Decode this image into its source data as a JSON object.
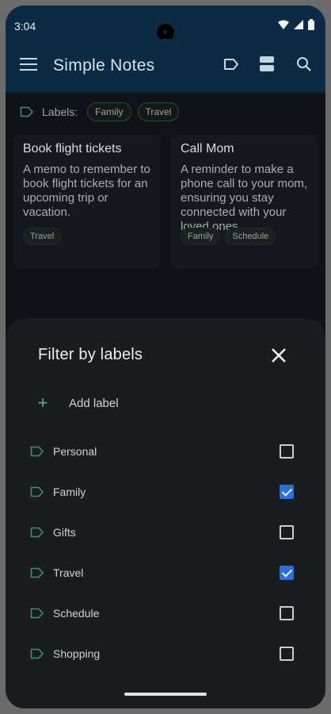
{
  "status_bar": {
    "time": "3:04"
  },
  "app_bar": {
    "title": "Simple Notes"
  },
  "labels_row": {
    "label": "Labels:",
    "chips": [
      "Family",
      "Travel"
    ]
  },
  "notes": [
    {
      "title": "Book flight tickets",
      "body": "A memo to remember to book flight tickets for an upcoming trip or vacation.",
      "chips": [
        "Travel"
      ]
    },
    {
      "title": "Call Mom",
      "body": "A reminder to make a phone call to your mom, ensuring you stay connected with your loved ones.",
      "chips": [
        "Family",
        "Schedule"
      ]
    }
  ],
  "sheet": {
    "title": "Filter by labels",
    "add_label": "Add label",
    "labels": [
      {
        "name": "Personal",
        "checked": false
      },
      {
        "name": "Family",
        "checked": true
      },
      {
        "name": "Gifts",
        "checked": false
      },
      {
        "name": "Travel",
        "checked": true
      },
      {
        "name": "Schedule",
        "checked": false
      },
      {
        "name": "Shopping",
        "checked": false
      }
    ]
  },
  "colors": {
    "accent": "#4fb39a",
    "checkbox": "#2c6fd6",
    "app_bar": "#0b2a44"
  }
}
